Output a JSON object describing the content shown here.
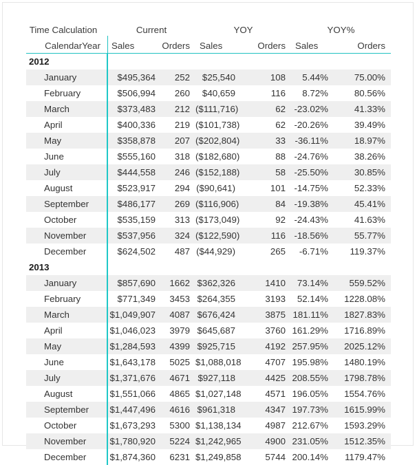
{
  "visual": {
    "header": {
      "row_label_top": "Time Calculation",
      "row_label_bottom": "CalendarYear",
      "groups": [
        {
          "name": "Current",
          "measures": [
            "Sales",
            "Orders"
          ]
        },
        {
          "name": "YOY",
          "measures": [
            "Sales",
            "Orders"
          ]
        },
        {
          "name": "YOY%",
          "measures": [
            "Sales",
            "Orders"
          ]
        }
      ],
      "accent_color": "#1fc1c1"
    },
    "columns": [
      "CalendarYear",
      "Current Sales",
      "Current Orders",
      "YOY Sales",
      "YOY Orders",
      "YOY% Sales",
      "YOY% Orders"
    ],
    "rows": [
      {
        "type": "year",
        "label": "2012",
        "values": [
          "",
          "",
          "",
          "",
          "",
          ""
        ]
      },
      {
        "type": "month",
        "label": "January",
        "values": [
          "$495,364",
          "252",
          "$25,540",
          "108",
          "5.44%",
          "75.00%"
        ]
      },
      {
        "type": "month",
        "label": "February",
        "values": [
          "$506,994",
          "260",
          "$40,659",
          "116",
          "8.72%",
          "80.56%"
        ]
      },
      {
        "type": "month",
        "label": "March",
        "values": [
          "$373,483",
          "212",
          "($111,716)",
          "62",
          "-23.02%",
          "41.33%"
        ]
      },
      {
        "type": "month",
        "label": "April",
        "values": [
          "$400,336",
          "219",
          "($101,738)",
          "62",
          "-20.26%",
          "39.49%"
        ]
      },
      {
        "type": "month",
        "label": "May",
        "values": [
          "$358,878",
          "207",
          "($202,804)",
          "33",
          "-36.11%",
          "18.97%"
        ]
      },
      {
        "type": "month",
        "label": "June",
        "values": [
          "$555,160",
          "318",
          "($182,680)",
          "88",
          "-24.76%",
          "38.26%"
        ]
      },
      {
        "type": "month",
        "label": "July",
        "values": [
          "$444,558",
          "246",
          "($152,188)",
          "58",
          "-25.50%",
          "30.85%"
        ]
      },
      {
        "type": "month",
        "label": "August",
        "values": [
          "$523,917",
          "294",
          "($90,641)",
          "101",
          "-14.75%",
          "52.33%"
        ]
      },
      {
        "type": "month",
        "label": "September",
        "values": [
          "$486,177",
          "269",
          "($116,906)",
          "84",
          "-19.38%",
          "45.41%"
        ]
      },
      {
        "type": "month",
        "label": "October",
        "values": [
          "$535,159",
          "313",
          "($173,049)",
          "92",
          "-24.43%",
          "41.63%"
        ]
      },
      {
        "type": "month",
        "label": "November",
        "values": [
          "$537,956",
          "324",
          "($122,590)",
          "116",
          "-18.56%",
          "55.77%"
        ]
      },
      {
        "type": "month",
        "label": "December",
        "values": [
          "$624,502",
          "487",
          "($44,929)",
          "265",
          "-6.71%",
          "119.37%"
        ]
      },
      {
        "type": "year",
        "label": "2013",
        "values": [
          "",
          "",
          "",
          "",
          "",
          ""
        ]
      },
      {
        "type": "month",
        "label": "January",
        "values": [
          "$857,690",
          "1662",
          "$362,326",
          "1410",
          "73.14%",
          "559.52%"
        ]
      },
      {
        "type": "month",
        "label": "February",
        "values": [
          "$771,349",
          "3453",
          "$264,355",
          "3193",
          "52.14%",
          "1228.08%"
        ]
      },
      {
        "type": "month",
        "label": "March",
        "values": [
          "$1,049,907",
          "4087",
          "$676,424",
          "3875",
          "181.11%",
          "1827.83%"
        ]
      },
      {
        "type": "month",
        "label": "April",
        "values": [
          "$1,046,023",
          "3979",
          "$645,687",
          "3760",
          "161.29%",
          "1716.89%"
        ]
      },
      {
        "type": "month",
        "label": "May",
        "values": [
          "$1,284,593",
          "4399",
          "$925,715",
          "4192",
          "257.95%",
          "2025.12%"
        ]
      },
      {
        "type": "month",
        "label": "June",
        "values": [
          "$1,643,178",
          "5025",
          "$1,088,018",
          "4707",
          "195.98%",
          "1480.19%"
        ]
      },
      {
        "type": "month",
        "label": "July",
        "values": [
          "$1,371,676",
          "4671",
          "$927,118",
          "4425",
          "208.55%",
          "1798.78%"
        ]
      },
      {
        "type": "month",
        "label": "August",
        "values": [
          "$1,551,066",
          "4865",
          "$1,027,148",
          "4571",
          "196.05%",
          "1554.76%"
        ]
      },
      {
        "type": "month",
        "label": "September",
        "values": [
          "$1,447,496",
          "4616",
          "$961,318",
          "4347",
          "197.73%",
          "1615.99%"
        ]
      },
      {
        "type": "month",
        "label": "October",
        "values": [
          "$1,673,293",
          "5300",
          "$1,138,134",
          "4987",
          "212.67%",
          "1593.29%"
        ]
      },
      {
        "type": "month",
        "label": "November",
        "values": [
          "$1,780,920",
          "5224",
          "$1,242,965",
          "4900",
          "231.05%",
          "1512.35%"
        ]
      },
      {
        "type": "month",
        "label": "December",
        "values": [
          "$1,874,360",
          "6231",
          "$1,249,858",
          "5744",
          "200.14%",
          "1179.47%"
        ]
      }
    ]
  }
}
